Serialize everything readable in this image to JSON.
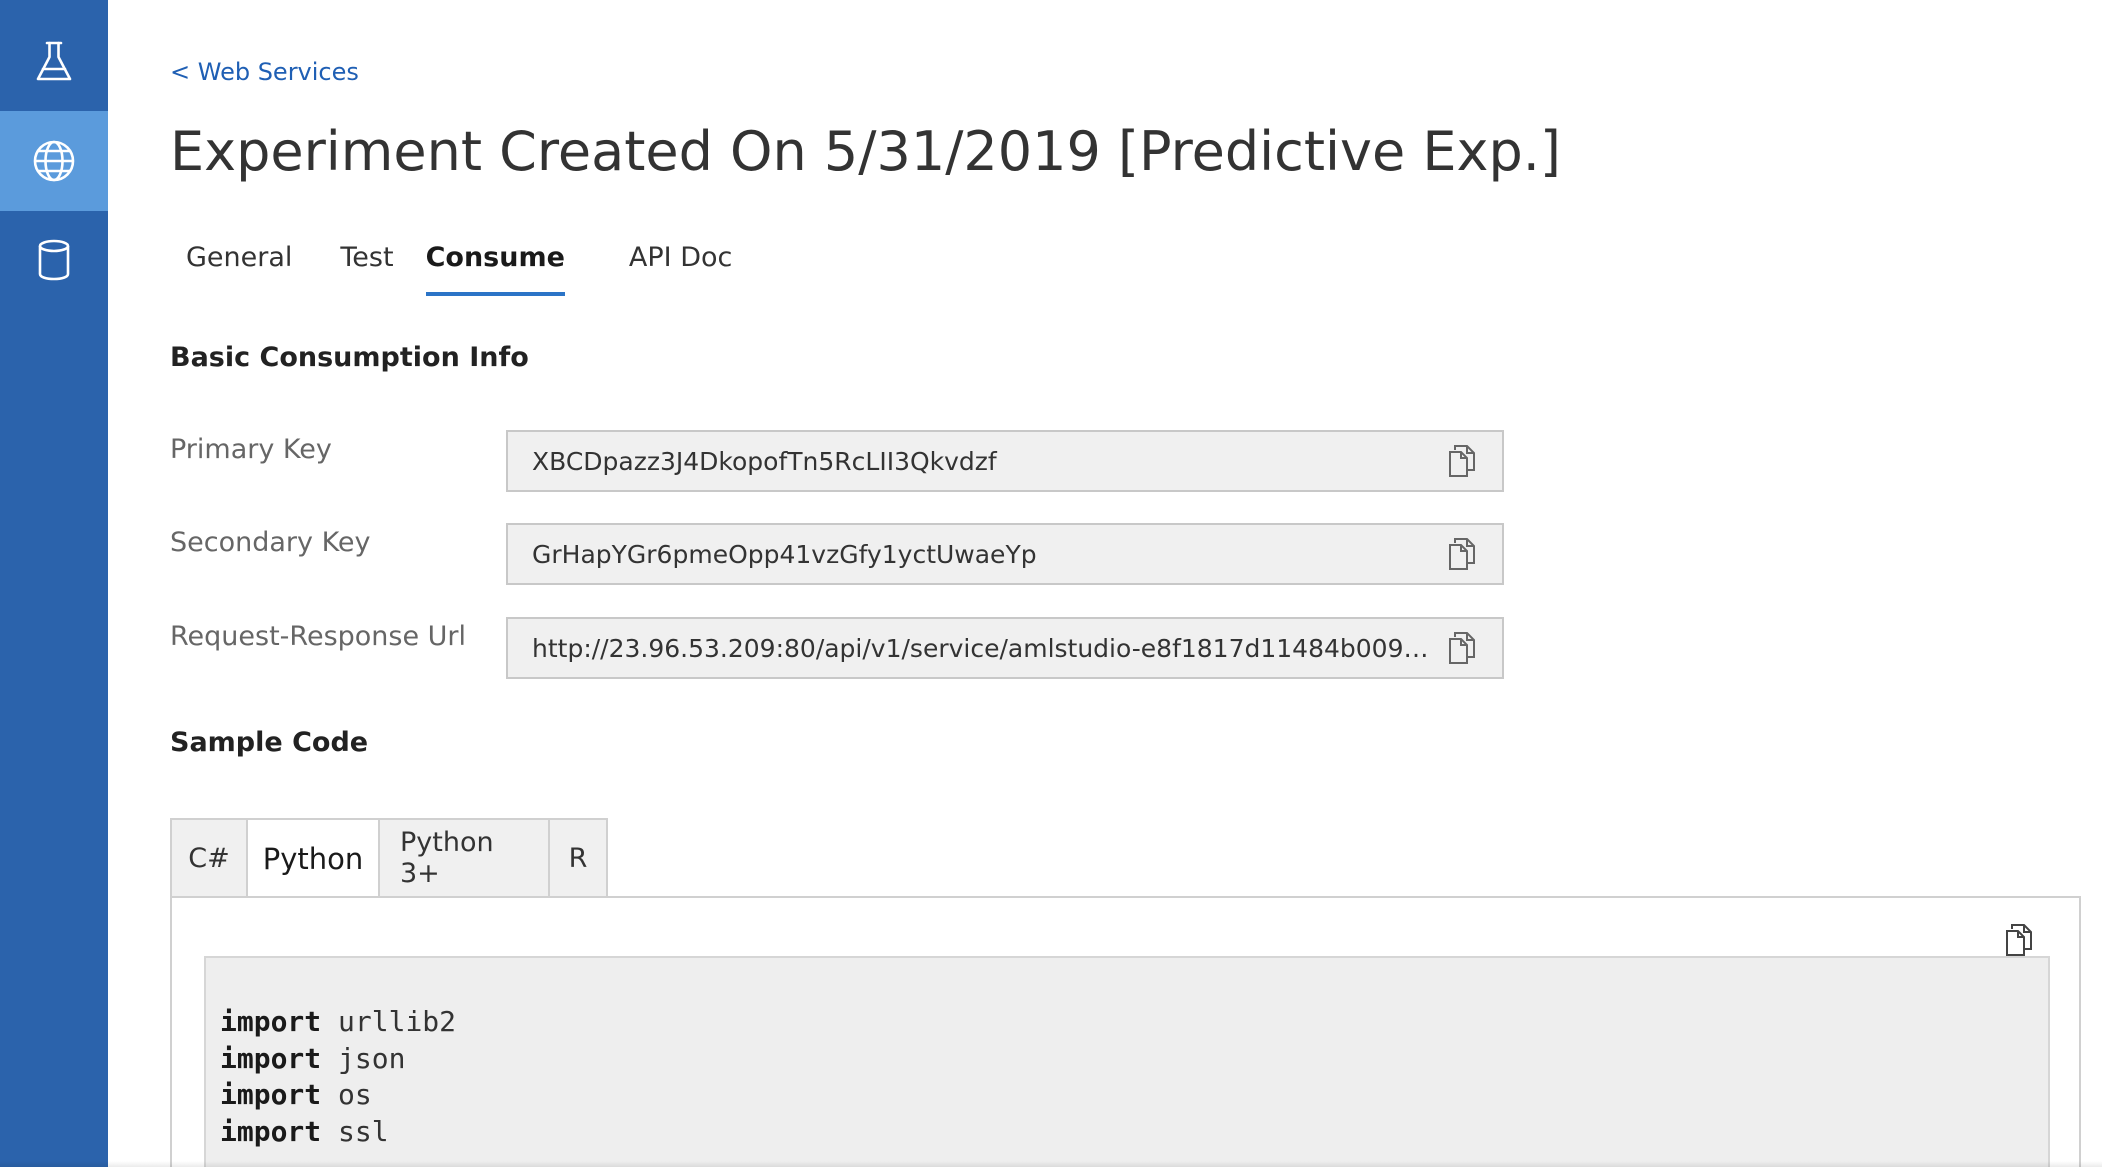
{
  "sidebar": {
    "items": [
      {
        "icon": "flask-icon",
        "active": false
      },
      {
        "icon": "globe-icon",
        "active": true
      },
      {
        "icon": "database-icon",
        "active": false
      }
    ],
    "background": "#2b63ac",
    "active_background": "#5b9bdc"
  },
  "header": {
    "back_link": "< Web Services",
    "title": "Experiment Created On 5/31/2019 [Predictive Exp.]"
  },
  "tabs": [
    {
      "label": "General",
      "active": false
    },
    {
      "label": "Test",
      "active": false
    },
    {
      "label": "Consume",
      "active": true
    },
    {
      "label": "API Doc",
      "active": false
    }
  ],
  "basic_info": {
    "title": "Basic Consumption Info",
    "fields": [
      {
        "label": "Primary Key",
        "value": "XBCDpazz3J4DkopofTn5RcLII3Qkvdzf"
      },
      {
        "label": "Secondary Key",
        "value": "GrHapYGr6pmeOpp41vzGfy1yctUwaeYp"
      },
      {
        "label": "Request-Response Url",
        "value": "http://23.96.53.209:80/api/v1/service/amlstudio-e8f1817d11484b009b913b..."
      }
    ]
  },
  "sample_code": {
    "title": "Sample Code",
    "tabs": [
      {
        "label": "C#",
        "active": false
      },
      {
        "label": "Python",
        "active": true
      },
      {
        "label": "Python 3+",
        "active": false
      },
      {
        "label": "R",
        "active": false
      }
    ],
    "lines": [
      {
        "keyword": "import",
        "rest": " urllib2"
      },
      {
        "keyword": "import",
        "rest": " json"
      },
      {
        "keyword": "import",
        "rest": " os"
      },
      {
        "keyword": "import",
        "rest": " ssl"
      }
    ]
  },
  "colors": {
    "accent": "#2b74c7",
    "link": "#1f5fb4"
  }
}
